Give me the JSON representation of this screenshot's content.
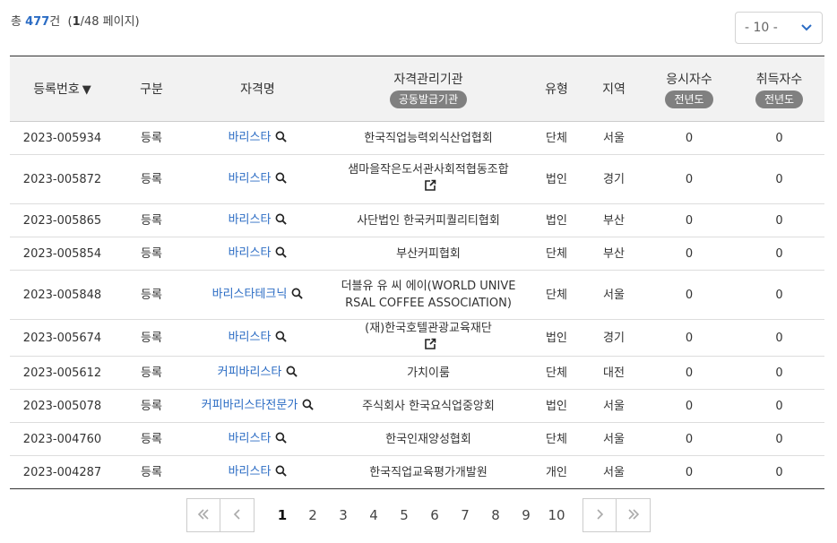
{
  "summary": {
    "prefix": "총",
    "total": "477",
    "unit": "건",
    "page_open": "(",
    "current_page": "1",
    "page_rest": "/48 페이지)"
  },
  "page_size": {
    "value": "- 10 -"
  },
  "table": {
    "headers": {
      "reg_no": "등록번호",
      "sort_glyph": "▼",
      "type": "구분",
      "name": "자격명",
      "org": "자격관리기관",
      "org_pill": "공동발급기관",
      "kind": "유형",
      "region": "지역",
      "applicants": "응시자수",
      "applicants_pill": "전년도",
      "acquirers": "취득자수",
      "acquirers_pill": "전년도"
    },
    "rows": [
      {
        "reg_no": "2023-005934",
        "type": "등록",
        "name": "바리스타",
        "org_l1": "한국직업능력외식산업협회",
        "org_l2": "",
        "org_link": false,
        "kind": "단체",
        "region": "서울",
        "applicants": "0",
        "acquirers": "0"
      },
      {
        "reg_no": "2023-005872",
        "type": "등록",
        "name": "바리스타",
        "org_l1": "샘마을작은도서관사회적협동조합",
        "org_l2": "",
        "org_link": true,
        "kind": "법인",
        "region": "경기",
        "applicants": "0",
        "acquirers": "0"
      },
      {
        "reg_no": "2023-005865",
        "type": "등록",
        "name": "바리스타",
        "org_l1": "사단법인 한국커피퀄리티협회",
        "org_l2": "",
        "org_link": false,
        "kind": "법인",
        "region": "부산",
        "applicants": "0",
        "acquirers": "0"
      },
      {
        "reg_no": "2023-005854",
        "type": "등록",
        "name": "바리스타",
        "org_l1": "부산커피협회",
        "org_l2": "",
        "org_link": false,
        "kind": "단체",
        "region": "부산",
        "applicants": "0",
        "acquirers": "0"
      },
      {
        "reg_no": "2023-005848",
        "type": "등록",
        "name": "바리스타테크닉",
        "org_l1": "더블유 유 씨 에이(WORLD UNIVE",
        "org_l2": "RSAL COFFEE ASSOCIATION)",
        "org_link": false,
        "kind": "단체",
        "region": "서울",
        "applicants": "0",
        "acquirers": "0"
      },
      {
        "reg_no": "2023-005674",
        "type": "등록",
        "name": "바리스타",
        "org_l1": "(재)한국호텔관광교육재단",
        "org_l2": "",
        "org_link": true,
        "kind": "법인",
        "region": "경기",
        "applicants": "0",
        "acquirers": "0"
      },
      {
        "reg_no": "2023-005612",
        "type": "등록",
        "name": "커피바리스타",
        "org_l1": "가치이룸",
        "org_l2": "",
        "org_link": false,
        "kind": "단체",
        "region": "대전",
        "applicants": "0",
        "acquirers": "0"
      },
      {
        "reg_no": "2023-005078",
        "type": "등록",
        "name": "커피바리스타전문가",
        "org_l1": "주식회사 한국요식업중앙회",
        "org_l2": "",
        "org_link": false,
        "kind": "법인",
        "region": "서울",
        "applicants": "0",
        "acquirers": "0"
      },
      {
        "reg_no": "2023-004760",
        "type": "등록",
        "name": "바리스타",
        "org_l1": "한국인재양성협회",
        "org_l2": "",
        "org_link": false,
        "kind": "단체",
        "region": "서울",
        "applicants": "0",
        "acquirers": "0"
      },
      {
        "reg_no": "2023-004287",
        "type": "등록",
        "name": "바리스타",
        "org_l1": "한국직업교육평가개발원",
        "org_l2": "",
        "org_link": false,
        "kind": "개인",
        "region": "서울",
        "applicants": "0",
        "acquirers": "0"
      }
    ]
  },
  "pagination": {
    "pages": [
      "1",
      "2",
      "3",
      "4",
      "5",
      "6",
      "7",
      "8",
      "9",
      "10"
    ],
    "active": "1"
  },
  "icons": {
    "sort": "sort-desc-icon",
    "search": "search-icon",
    "external": "external-link-icon",
    "first": "first-page-icon",
    "prev": "prev-page-icon",
    "next": "next-page-icon",
    "last": "last-page-icon",
    "dropdown": "chevron-down-icon"
  },
  "colors": {
    "accent": "#2b6cc4",
    "pill": "#808080",
    "header_bg": "#f2f2f2"
  }
}
